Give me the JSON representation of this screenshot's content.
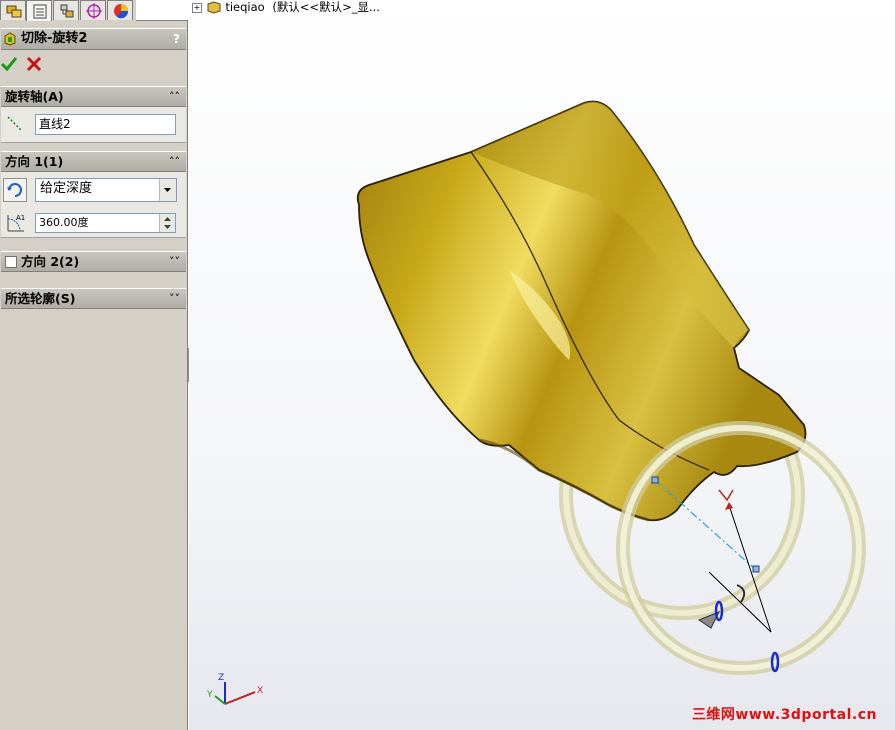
{
  "feature": {
    "title": "切除-旋转2",
    "help": "?"
  },
  "sections": {
    "axis": {
      "title": "旋转轴(A)",
      "value": "直线2"
    },
    "direction1": {
      "title": "方向 1(1)",
      "end_condition": "给定深度",
      "angle": "360.00度"
    },
    "direction2": {
      "title": "方向 2(2)",
      "checked": false
    },
    "contours": {
      "title": "所选轮廓(S)"
    }
  },
  "tree": {
    "root": "tieqiao",
    "config": "(默认<<默认>_显..."
  },
  "triad": {
    "x": "X",
    "y": "Y",
    "z": "Z"
  },
  "watermark": "三维网www.3dportal.cn",
  "colors": {
    "accept": "#1a9a1a",
    "cancel": "#cc1111",
    "part": "#c9a812",
    "ring": "#e8e6c8",
    "axis_line": "#2aa0d8"
  }
}
